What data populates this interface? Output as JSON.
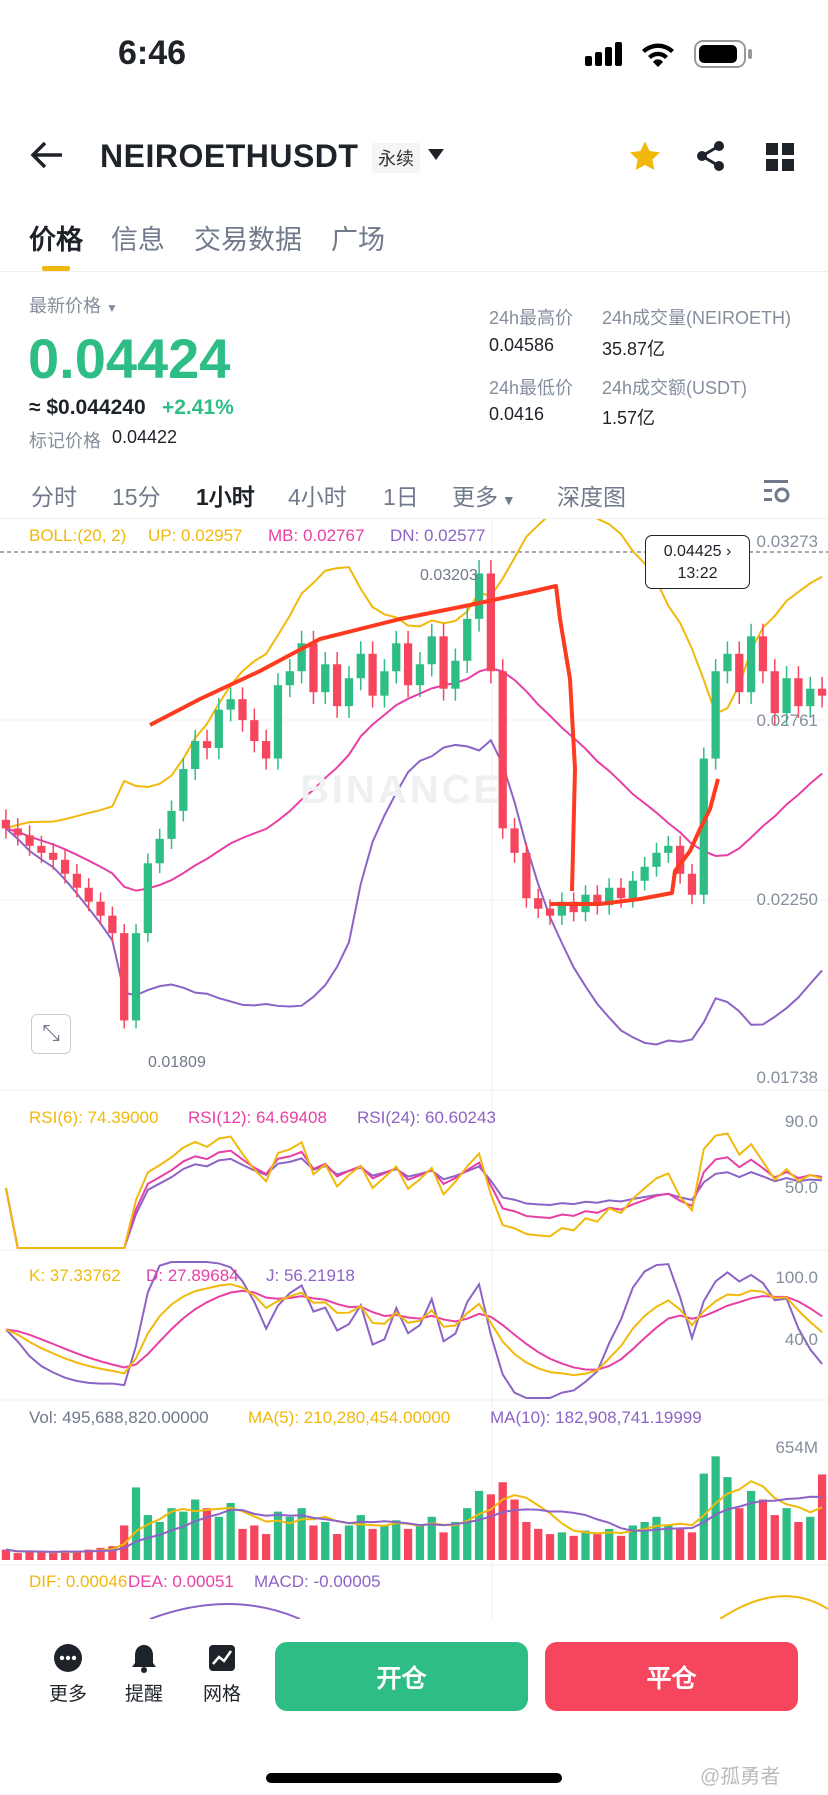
{
  "status": {
    "time": "6:46"
  },
  "header": {
    "symbol": "NEIROETHUSDT",
    "contract_type": "永续"
  },
  "tabs": [
    {
      "label": "价格"
    },
    {
      "label": "信息"
    },
    {
      "label": "交易数据"
    },
    {
      "label": "广场"
    }
  ],
  "ticker": {
    "latest_label": "最新价格",
    "price": "0.04424",
    "usd_price": "≈ $0.044240",
    "change": "+2.41%",
    "mark_label": "标记价格",
    "mark_price": "0.04422",
    "high_label": "24h最高价",
    "high": "0.04586",
    "vol_label": "24h成交量(NEIROETH)",
    "vol": "35.87亿",
    "low_label": "24h最低价",
    "low": "0.0416",
    "turnover_label": "24h成交额(USDT)",
    "turnover": "1.57亿"
  },
  "intervals": [
    {
      "label": "分时"
    },
    {
      "label": "15分"
    },
    {
      "label": "1小时"
    },
    {
      "label": "4小时"
    },
    {
      "label": "1日"
    },
    {
      "label": "更多"
    },
    {
      "label": "深度图"
    }
  ],
  "colors": {
    "up": "#2ebd85",
    "down": "#f6465d",
    "boll_up": "#f0b90b",
    "boll_mb": "#e83fa6",
    "boll_dn": "#8c63c6",
    "accent": "#f0b90b",
    "annotation": "#ff3b1f"
  },
  "chart_data": {
    "type": "candlestick",
    "boll_legend": {
      "name": "BOLL:(20, 2)",
      "up": "UP: 0.02957",
      "mb": "MB: 0.02767",
      "dn": "DN: 0.02577"
    },
    "price_axis": [
      "0.03273",
      "0.02761",
      "0.02250",
      "0.01738"
    ],
    "ylim": [
      0.01738,
      0.03273
    ],
    "last_price_tag": {
      "price": "0.04425",
      "time": "13:22"
    },
    "high_marker": "0.03203",
    "low_marker": "0.01809",
    "watermark": "BINANCE",
    "closes": [
      0.0245,
      0.0243,
      0.024,
      0.0238,
      0.0236,
      0.0232,
      0.0228,
      0.0224,
      0.022,
      0.0215,
      0.019,
      0.0215,
      0.0235,
      0.0242,
      0.025,
      0.0262,
      0.027,
      0.0268,
      0.0279,
      0.0282,
      0.0276,
      0.027,
      0.0265,
      0.0286,
      0.029,
      0.0298,
      0.0284,
      0.0292,
      0.028,
      0.0288,
      0.0295,
      0.0283,
      0.029,
      0.0298,
      0.0286,
      0.0292,
      0.03,
      0.0285,
      0.0293,
      0.0305,
      0.0318,
      0.029,
      0.0245,
      0.0238,
      0.0225,
      0.0222,
      0.022,
      0.0224,
      0.0221,
      0.0226,
      0.0223,
      0.0228,
      0.0225,
      0.023,
      0.0234,
      0.0238,
      0.024,
      0.0232,
      0.0226,
      0.0265,
      0.029,
      0.0295,
      0.0284,
      0.03,
      0.029,
      0.0278,
      0.0288,
      0.028,
      0.0285,
      0.0283
    ],
    "rsi_legend": {
      "rsi6": "RSI(6): 74.39000",
      "rsi12": "RSI(12): 64.69408",
      "rsi24": "RSI(24): 60.60243"
    },
    "rsi_axis": [
      "90.0",
      "50.0"
    ],
    "kdj_legend": {
      "k": "K: 37.33762",
      "d": "D: 27.89684",
      "j": "J: 56.21918"
    },
    "kdj_axis": [
      "100.0",
      "40.0"
    ],
    "vol_legend": {
      "vol": "Vol: 495,688,820.00000",
      "ma5": "MA(5): 210,280,454.00000",
      "ma10": "MA(10): 182,908,741.19999"
    },
    "vol_axis": [
      "654M"
    ],
    "volumes_m": [
      60,
      40,
      50,
      45,
      40,
      55,
      50,
      60,
      70,
      80,
      200,
      420,
      260,
      220,
      300,
      280,
      350,
      300,
      250,
      330,
      180,
      200,
      150,
      280,
      250,
      300,
      200,
      220,
      150,
      200,
      260,
      180,
      200,
      230,
      180,
      200,
      250,
      160,
      220,
      300,
      400,
      380,
      450,
      350,
      220,
      180,
      150,
      160,
      140,
      170,
      150,
      180,
      140,
      200,
      220,
      250,
      200,
      180,
      160,
      500,
      600,
      480,
      300,
      400,
      350,
      260,
      300,
      220,
      250,
      495
    ],
    "macd_legend": {
      "dif": "DIF: 0.00046",
      "dea": "DEA: 0.00051",
      "macd": "MACD: -0.00005"
    }
  },
  "bottom": {
    "more": "更多",
    "alert": "提醒",
    "grid": "网格",
    "open": "开仓",
    "close": "平仓"
  },
  "watermark_credit": "@孤勇者"
}
